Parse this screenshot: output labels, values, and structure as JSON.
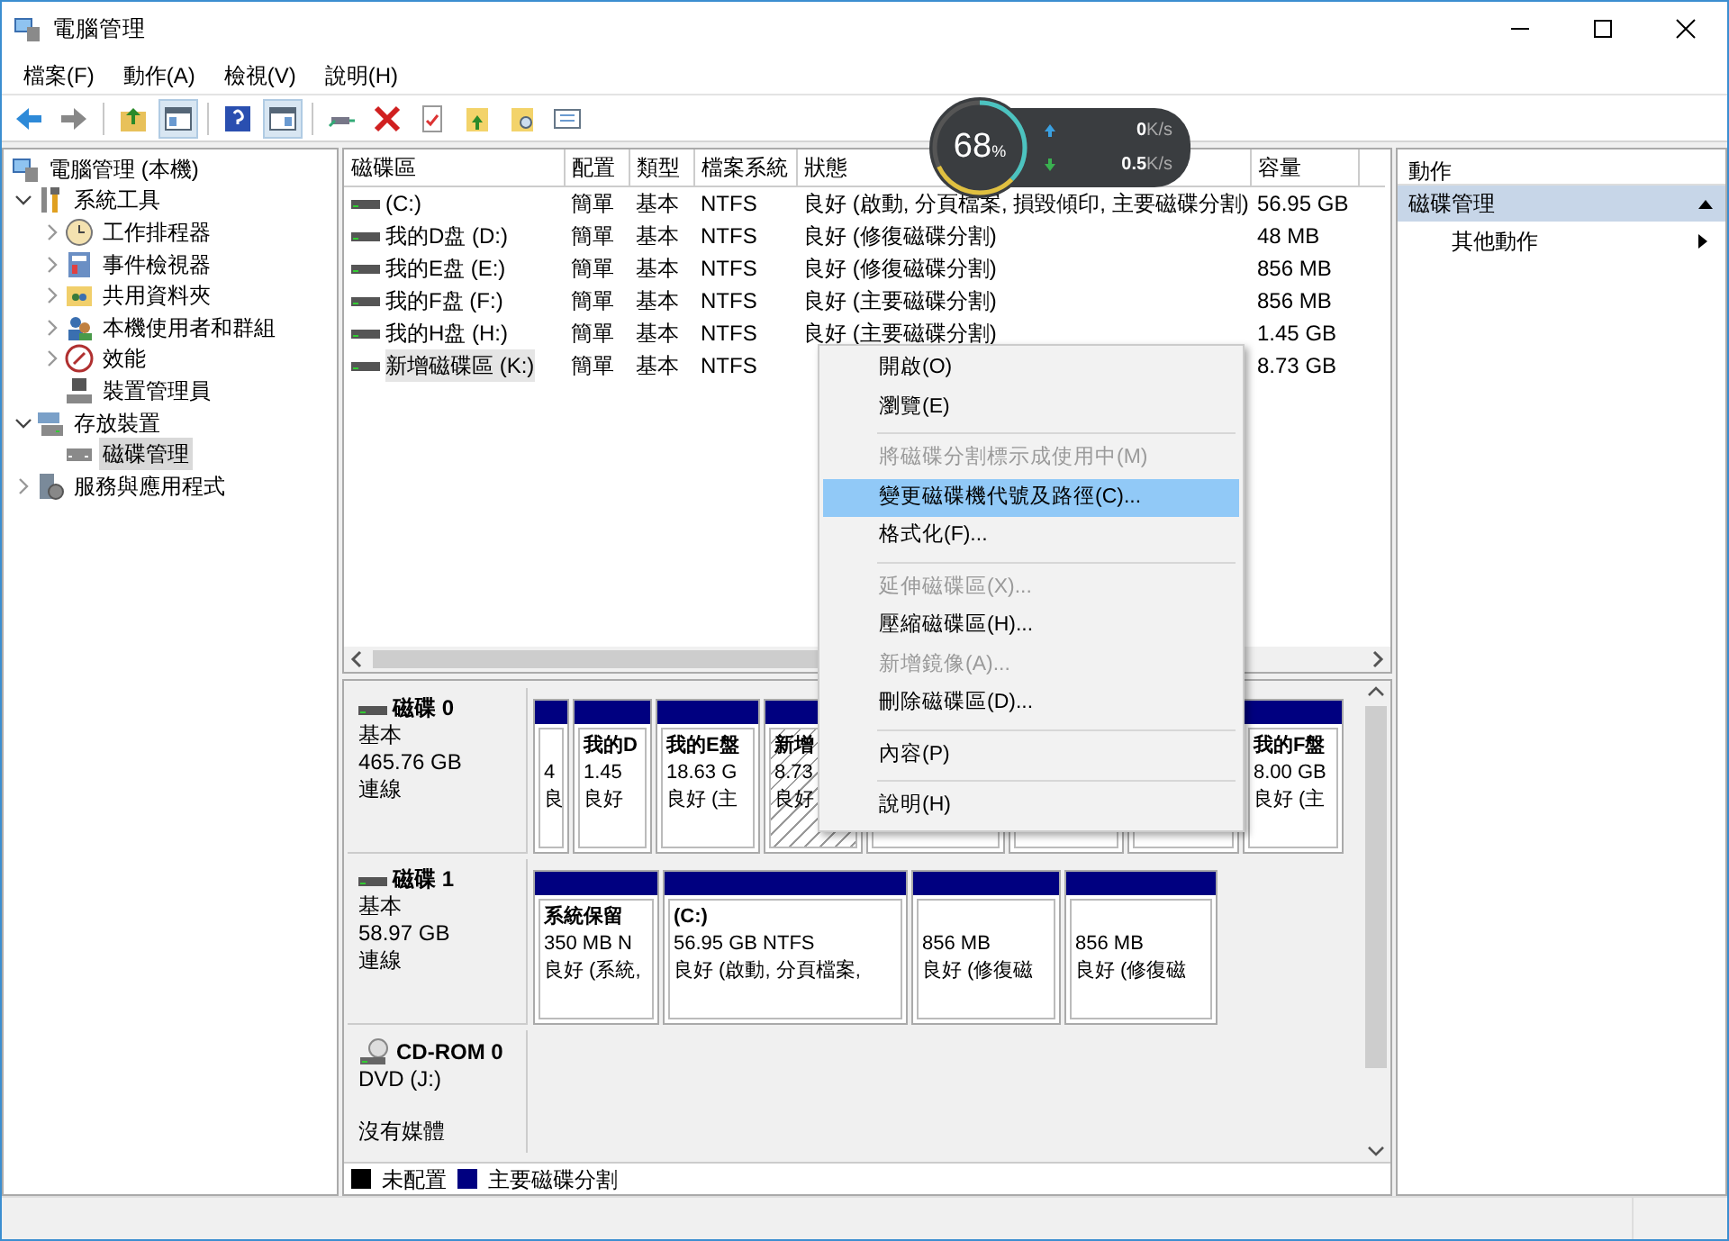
{
  "window": {
    "title": "電腦管理"
  },
  "menu_bar": [
    "檔案(F)",
    "動作(A)",
    "檢視(V)",
    "說明(H)"
  ],
  "net_widget": {
    "percent": "68",
    "percent_unit": "%",
    "upload": {
      "value": "0",
      "unit": "K/s"
    },
    "download": {
      "value": "0.5",
      "unit": "K/s"
    }
  },
  "tree": {
    "label": "電腦管理 (本機)",
    "selected": false,
    "children": [
      {
        "label": "系統工具",
        "expanded": true,
        "selected": false,
        "children": [
          {
            "label": "工作排程器",
            "expanded": false,
            "selected": false
          },
          {
            "label": "事件檢視器",
            "expanded": false,
            "selected": false
          },
          {
            "label": "共用資料夾",
            "expanded": false,
            "selected": false
          },
          {
            "label": "本機使用者和群組",
            "expanded": false,
            "selected": false
          },
          {
            "label": "效能",
            "expanded": false,
            "selected": false
          },
          {
            "label": "裝置管理員",
            "selected": false
          }
        ]
      },
      {
        "label": "存放裝置",
        "expanded": true,
        "selected": false,
        "children": [
          {
            "label": "磁碟管理",
            "selected": true
          }
        ]
      },
      {
        "label": "服務與應用程式",
        "expanded": false,
        "selected": false
      }
    ]
  },
  "volume_table": {
    "columns": [
      "磁碟區",
      "配置",
      "類型",
      "檔案系統",
      "狀態",
      "容量"
    ],
    "rows": [
      {
        "selected": false,
        "cells": [
          " (C:)",
          "簡單",
          "基本",
          "NTFS",
          "良好 (啟動, 分頁檔案, 損毀傾印, 主要磁碟分割)",
          "56.95 GB"
        ]
      },
      {
        "selected": false,
        "cells": [
          "我的D盘 (D:)",
          "簡單",
          "基本",
          "NTFS",
          "良好 (修復磁碟分割)",
          "48 MB"
        ]
      },
      {
        "selected": false,
        "cells": [
          "我的E盘 (E:)",
          "簡單",
          "基本",
          "NTFS",
          "良好 (修復磁碟分割)",
          "856 MB"
        ]
      },
      {
        "selected": false,
        "cells": [
          "我的F盘 (F:)",
          "簡單",
          "基本",
          "NTFS",
          "良好 (主要磁碟分割)",
          "856 MB"
        ]
      },
      {
        "selected": false,
        "cells": [
          "我的H盘 (H:)",
          "簡單",
          "基本",
          "NTFS",
          "良好 (主要磁碟分割)",
          "1.45 GB"
        ]
      },
      {
        "selected": true,
        "cells": [
          "新增磁碟區 (K:)",
          "簡單",
          "基本",
          "NTFS",
          "",
          "8.73 GB"
        ]
      }
    ]
  },
  "disks": [
    {
      "kind": "disk",
      "title": "磁碟 0",
      "type": "基本",
      "size": "465.76 GB",
      "state": "連線",
      "partitions": [
        {
          "selected": false,
          "size": "4",
          "status": "良"
        },
        {
          "selected": false,
          "name": "我的D",
          "size": "1.45",
          "status": "良好"
        },
        {
          "selected": false,
          "name": "我的E盤",
          "size": "18.63 G",
          "status": "良好 (主"
        },
        {
          "selected": true,
          "name": "新增",
          "size": "8.73",
          "status": "良好"
        },
        {
          "selected": false
        },
        {
          "selected": false
        },
        {
          "selected": false
        },
        {
          "selected": false,
          "name": "我的F盤",
          "size": "8.00 GB",
          "status": "良好 (主"
        }
      ]
    },
    {
      "kind": "disk",
      "title": "磁碟 1",
      "type": "基本",
      "size": "58.97 GB",
      "state": "連線",
      "partitions": [
        {
          "selected": false,
          "name": "系統保留",
          "size": "350 MB N",
          "status": "良好 (系統,"
        },
        {
          "selected": false,
          "name": " (C:)",
          "size": "56.95 GB NTFS",
          "status": "良好 (啟動, 分頁檔案,"
        },
        {
          "selected": false,
          "size": "856 MB",
          "status": "良好 (修復磁"
        },
        {
          "selected": false,
          "size": "856 MB",
          "status": "良好 (修復磁"
        }
      ]
    },
    {
      "kind": "cdrom",
      "title": "CD-ROM 0",
      "type": "DVD (J:)",
      "state": "沒有媒體"
    }
  ],
  "legend": [
    {
      "label": "未配置",
      "color": "#000000"
    },
    {
      "label": "主要磁碟分割",
      "color": "#000080"
    }
  ],
  "actions_panel": {
    "title": "動作",
    "section": {
      "label": "磁碟管理",
      "expanded": true
    },
    "items": [
      "其他動作"
    ]
  },
  "context_menu": [
    {
      "kind": "item",
      "label": "開啟(O)",
      "disabled": false,
      "selected": false
    },
    {
      "kind": "item",
      "label": "瀏覽(E)",
      "disabled": false,
      "selected": false
    },
    {
      "kind": "separator"
    },
    {
      "kind": "item",
      "label": "將磁碟分割標示成使用中(M)",
      "disabled": true,
      "selected": false
    },
    {
      "kind": "item",
      "label": "變更磁碟機代號及路徑(C)...",
      "disabled": false,
      "selected": true
    },
    {
      "kind": "item",
      "label": "格式化(F)...",
      "disabled": false,
      "selected": false
    },
    {
      "kind": "separator"
    },
    {
      "kind": "item",
      "label": "延伸磁碟區(X)...",
      "disabled": true,
      "selected": false
    },
    {
      "kind": "item",
      "label": "壓縮磁碟區(H)...",
      "disabled": false,
      "selected": false
    },
    {
      "kind": "item",
      "label": "新增鏡像(A)...",
      "disabled": true,
      "selected": false
    },
    {
      "kind": "item",
      "label": "刪除磁碟區(D)...",
      "disabled": false,
      "selected": false
    },
    {
      "kind": "separator"
    },
    {
      "kind": "item",
      "label": "內容(P)",
      "disabled": false,
      "selected": false
    },
    {
      "kind": "separator"
    },
    {
      "kind": "item",
      "label": "說明(H)",
      "disabled": false,
      "selected": false
    }
  ]
}
